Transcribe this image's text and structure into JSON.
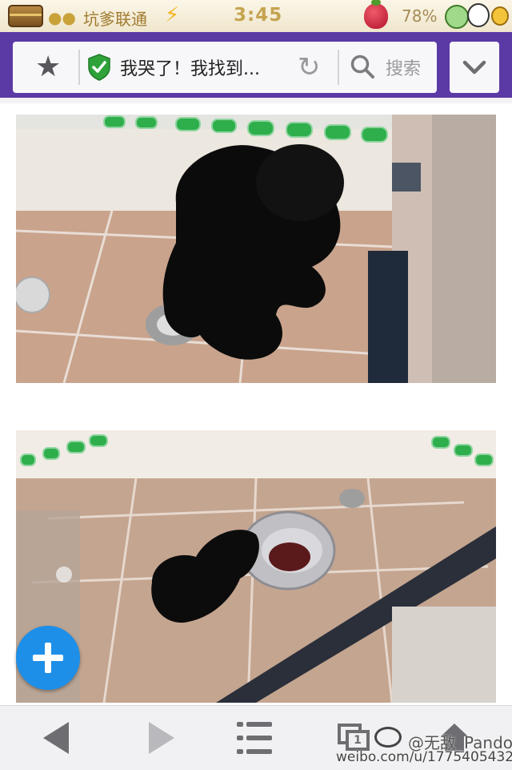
{
  "status_bar": {
    "carrier": "坑爹联通",
    "time": "3:45",
    "battery": "78%"
  },
  "address_bar": {
    "page_title": "我哭了！我找到...",
    "search_label": "搜索"
  },
  "toolbar": {
    "tab_count": "1"
  },
  "watermark": {
    "name": "@无敌_Pandora",
    "url": "weibo.com/u/1775405432"
  },
  "colors": {
    "nav_purple": "#5c3aa6",
    "secure_green": "#2fa33a",
    "fab_blue": "#1e8fe8"
  }
}
